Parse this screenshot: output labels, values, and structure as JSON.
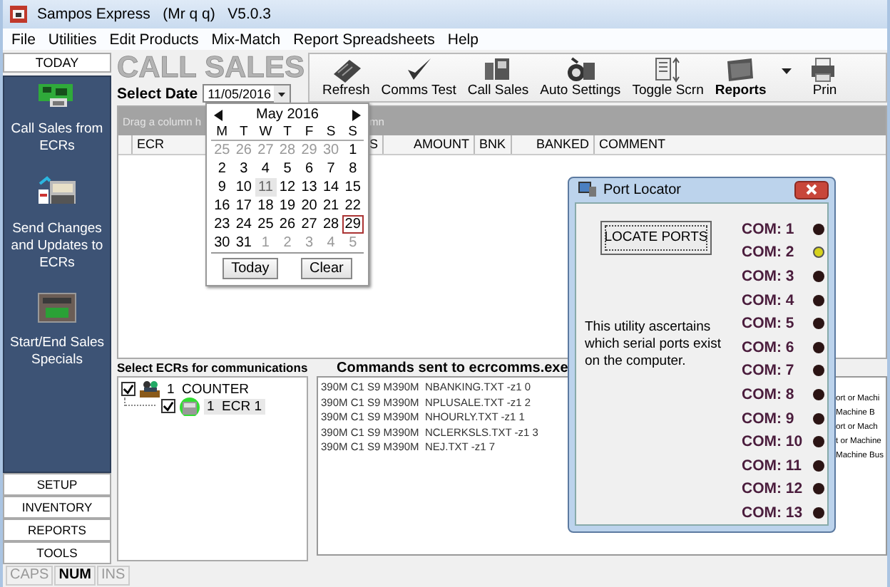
{
  "window": {
    "title": "Sampos Express   (Mr q q)   V5.0.3"
  },
  "menu": [
    "File",
    "Utilities",
    "Edit Products",
    "Mix-Match",
    "Report Spreadsheets",
    "Help"
  ],
  "sidebar": {
    "top_tab": "TODAY",
    "items": [
      {
        "label": "Call Sales from ECRs"
      },
      {
        "label": "Send Changes and Updates to ECRs"
      },
      {
        "label": "Start/End Sales Specials"
      }
    ],
    "nav": [
      "SETUP",
      "INVENTORY",
      "REPORTS",
      "TOOLS"
    ]
  },
  "page_title": "CALL SALES",
  "date_picker": {
    "label": "Select Date",
    "value": "11/05/2016"
  },
  "toolbar": [
    {
      "label": "Refresh",
      "has_menu": false
    },
    {
      "label": "Comms Test",
      "has_menu": false
    },
    {
      "label": "Call Sales",
      "has_menu": false
    },
    {
      "label": "Auto Settings",
      "has_menu": false
    },
    {
      "label": "Toggle Scrn",
      "has_menu": false
    },
    {
      "label": "Reports",
      "has_menu": true
    },
    {
      "label": "Prin",
      "has_menu": false
    }
  ],
  "grid": {
    "group_hint_left": "Drag a column h",
    "group_hint_right": "mn",
    "columns": [
      "ECR",
      "S",
      "AMOUNT",
      "BNK",
      "BANKED",
      "COMMENT"
    ]
  },
  "calendar": {
    "month": "May 2016",
    "day_names": [
      "M",
      "T",
      "W",
      "T",
      "F",
      "S",
      "S"
    ],
    "weeks": [
      [
        {
          "day": "25",
          "other_month": true,
          "selected": false,
          "today": false
        },
        {
          "day": "26",
          "other_month": true,
          "selected": false,
          "today": false
        },
        {
          "day": "27",
          "other_month": true,
          "selected": false,
          "today": false
        },
        {
          "day": "28",
          "other_month": true,
          "selected": false,
          "today": false
        },
        {
          "day": "29",
          "other_month": true,
          "selected": false,
          "today": false
        },
        {
          "day": "30",
          "other_month": true,
          "selected": false,
          "today": false
        },
        {
          "day": "1",
          "other_month": false,
          "selected": false,
          "today": false
        }
      ],
      [
        {
          "day": "2",
          "other_month": false,
          "selected": false,
          "today": false
        },
        {
          "day": "3",
          "other_month": false,
          "selected": false,
          "today": false
        },
        {
          "day": "4",
          "other_month": false,
          "selected": false,
          "today": false
        },
        {
          "day": "5",
          "other_month": false,
          "selected": false,
          "today": false
        },
        {
          "day": "6",
          "other_month": false,
          "selected": false,
          "today": false
        },
        {
          "day": "7",
          "other_month": false,
          "selected": false,
          "today": false
        },
        {
          "day": "8",
          "other_month": false,
          "selected": false,
          "today": false
        }
      ],
      [
        {
          "day": "9",
          "other_month": false,
          "selected": false,
          "today": false
        },
        {
          "day": "10",
          "other_month": false,
          "selected": false,
          "today": false
        },
        {
          "day": "11",
          "other_month": false,
          "selected": true,
          "today": false
        },
        {
          "day": "12",
          "other_month": false,
          "selected": false,
          "today": false
        },
        {
          "day": "13",
          "other_month": false,
          "selected": false,
          "today": false
        },
        {
          "day": "14",
          "other_month": false,
          "selected": false,
          "today": false
        },
        {
          "day": "15",
          "other_month": false,
          "selected": false,
          "today": false
        }
      ],
      [
        {
          "day": "16",
          "other_month": false,
          "selected": false,
          "today": false
        },
        {
          "day": "17",
          "other_month": false,
          "selected": false,
          "today": false
        },
        {
          "day": "18",
          "other_month": false,
          "selected": false,
          "today": false
        },
        {
          "day": "19",
          "other_month": false,
          "selected": false,
          "today": false
        },
        {
          "day": "20",
          "other_month": false,
          "selected": false,
          "today": false
        },
        {
          "day": "21",
          "other_month": false,
          "selected": false,
          "today": false
        },
        {
          "day": "22",
          "other_month": false,
          "selected": false,
          "today": false
        }
      ],
      [
        {
          "day": "23",
          "other_month": false,
          "selected": false,
          "today": false
        },
        {
          "day": "24",
          "other_month": false,
          "selected": false,
          "today": false
        },
        {
          "day": "25",
          "other_month": false,
          "selected": false,
          "today": false
        },
        {
          "day": "26",
          "other_month": false,
          "selected": false,
          "today": false
        },
        {
          "day": "27",
          "other_month": false,
          "selected": false,
          "today": false
        },
        {
          "day": "28",
          "other_month": false,
          "selected": false,
          "today": false
        },
        {
          "day": "29",
          "other_month": false,
          "selected": false,
          "today": true
        }
      ],
      [
        {
          "day": "30",
          "other_month": false,
          "selected": false,
          "today": false
        },
        {
          "day": "31",
          "other_month": false,
          "selected": false,
          "today": false
        },
        {
          "day": "1",
          "other_month": true,
          "selected": false,
          "today": false
        },
        {
          "day": "2",
          "other_month": true,
          "selected": false,
          "today": false
        },
        {
          "day": "3",
          "other_month": true,
          "selected": false,
          "today": false
        },
        {
          "day": "4",
          "other_month": true,
          "selected": false,
          "today": false
        },
        {
          "day": "5",
          "other_month": true,
          "selected": false,
          "today": false
        }
      ]
    ],
    "buttons": [
      "Today",
      "Clear"
    ]
  },
  "ecr_tree": {
    "label": "Select ECRs for communications",
    "nodes": [
      {
        "label": "1  COUNTER",
        "checked": true,
        "selected": false,
        "children": [
          {
            "label": "1  ECR 1",
            "checked": true,
            "selected": true
          }
        ]
      }
    ]
  },
  "commands": {
    "label": "Commands sent to ecrcomms.exe",
    "lines": [
      "390M C1 S9 M390M  NBANKING.TXT -z1 0",
      "390M C1 S9 M390M  NPLUSALE.TXT -z1 2",
      "390M C1 S9 M390M  NHOURLY.TXT -z1 1",
      "390M C1 S9 M390M  NCLERKSLS.TXT -z1 3",
      "390M C1 S9 M390M  NEJ.TXT -z1 7"
    ]
  },
  "hidden_panel_lines": [
    "ort or Machi",
    "Machine B",
    "ort or Mach",
    "t or Machine",
    "Machine Bus"
  ],
  "port_locator": {
    "title": "Port Locator",
    "button": "LOCATE PORTS",
    "description": "This utility ascertains which serial ports exist on the computer.",
    "ports": [
      {
        "label": "COM: 1",
        "on": false
      },
      {
        "label": "COM: 2",
        "on": true
      },
      {
        "label": "COM: 3",
        "on": false
      },
      {
        "label": "COM: 4",
        "on": false
      },
      {
        "label": "COM: 5",
        "on": false
      },
      {
        "label": "COM: 6",
        "on": false
      },
      {
        "label": "COM: 7",
        "on": false
      },
      {
        "label": "COM: 8",
        "on": false
      },
      {
        "label": "COM: 9",
        "on": false
      },
      {
        "label": "COM: 10",
        "on": false
      },
      {
        "label": "COM: 11",
        "on": false
      },
      {
        "label": "COM: 12",
        "on": false
      },
      {
        "label": "COM: 13",
        "on": false
      }
    ]
  },
  "status_bar": [
    {
      "label": "CAPS",
      "on": false
    },
    {
      "label": "NUM",
      "on": true
    },
    {
      "label": "INS",
      "on": false
    }
  ]
}
